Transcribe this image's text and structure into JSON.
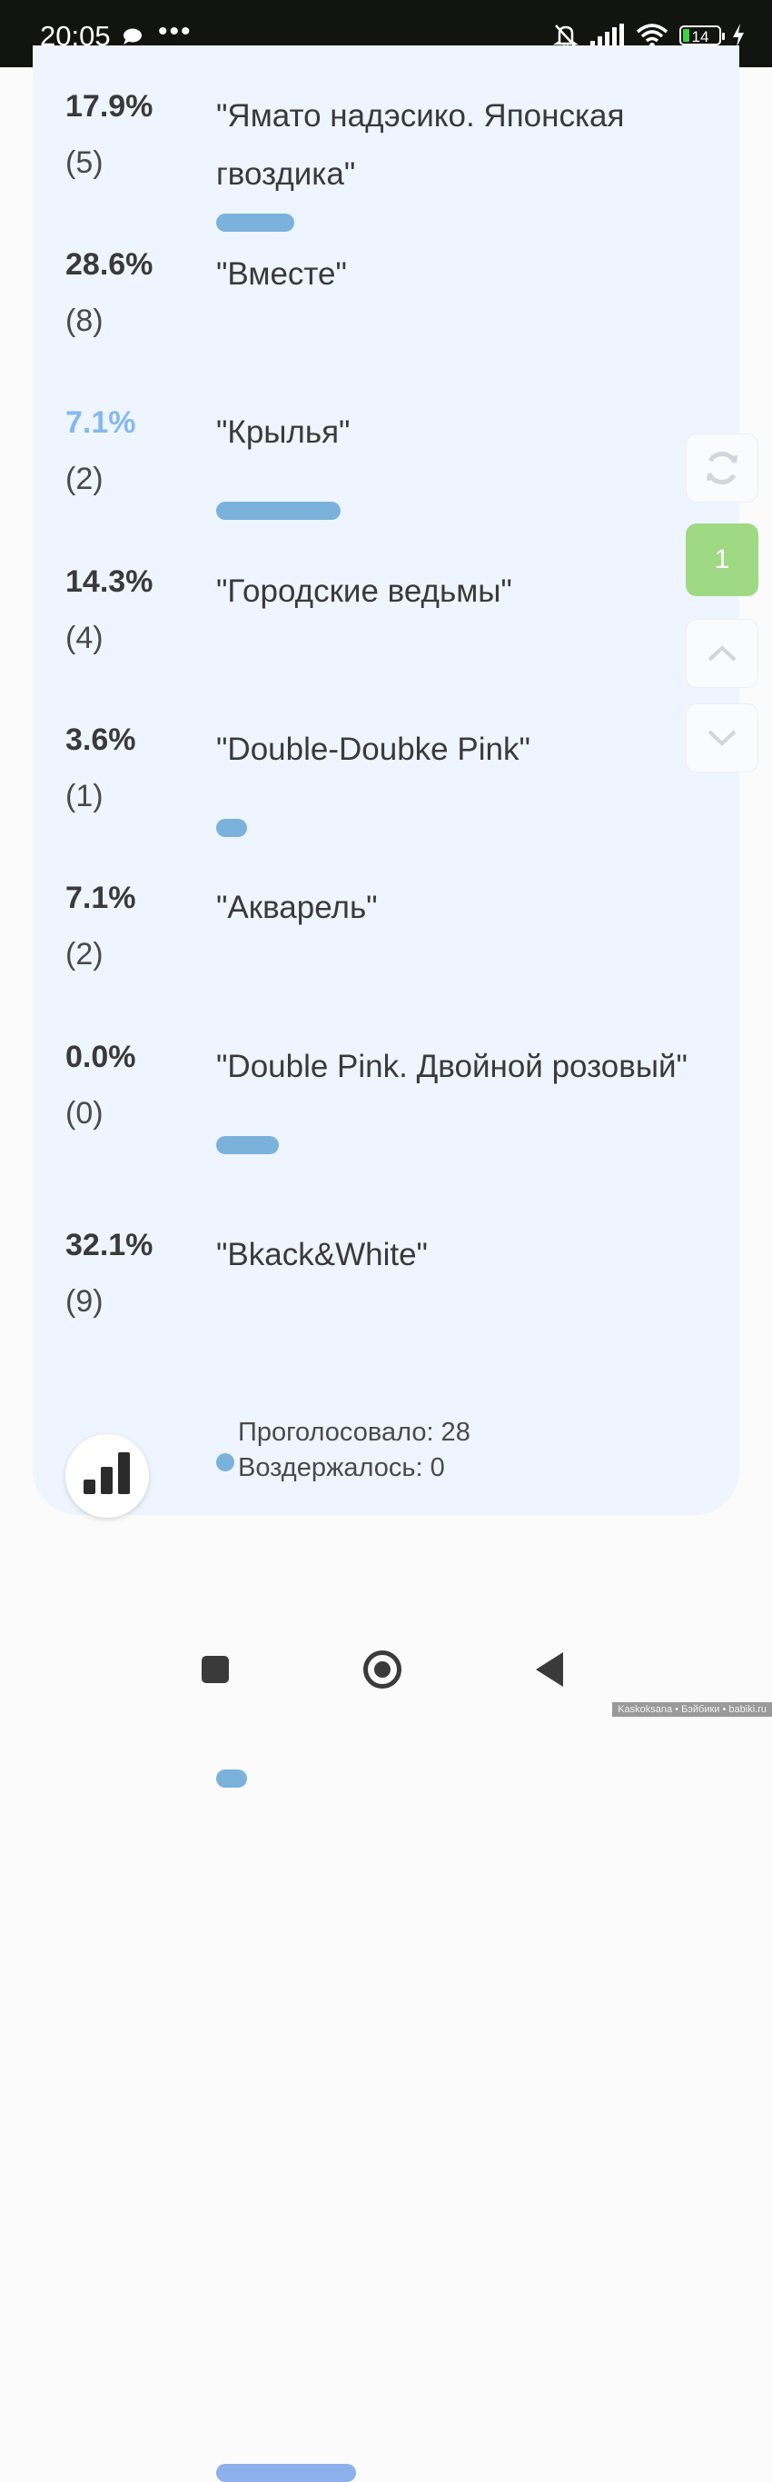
{
  "status_bar": {
    "time": "20:05",
    "overflow": "•••",
    "battery": "14",
    "icons": [
      "chat-bubble-icon",
      "bell-off-icon",
      "signal-icon",
      "wifi-icon",
      "battery-icon",
      "charging-icon"
    ]
  },
  "poll": {
    "options": [
      {
        "percent": "17.9%",
        "count": "(5)",
        "title": "\"Ямато надэсико. Японская гвоздика\"",
        "fraction": 0.179
      },
      {
        "percent": "28.6%",
        "count": "(8)",
        "title": "\"Вместе\"",
        "fraction": 0.286
      },
      {
        "percent": "7.1%",
        "count": "(2)",
        "title": "\"Крылья\"",
        "fraction": 0.071
      },
      {
        "percent": "14.3%",
        "count": "(4)",
        "title": "\"Городские ведьмы\"",
        "fraction": 0.143
      },
      {
        "percent": "3.6%",
        "count": "(1)",
        "title": "\"Double-Doubke Pink\"",
        "fraction": 0.036
      },
      {
        "percent": "7.1%",
        "count": "(2)",
        "title": "\"Акварель\"",
        "fraction": 0.071
      },
      {
        "percent": "0.0%",
        "count": "(0)",
        "title": "\"Double Pink. Двойной розовый\"",
        "fraction": 0.0
      },
      {
        "percent": "32.1%",
        "count": "(9)",
        "title": "\"Bkack&White\"",
        "fraction": 0.321
      }
    ],
    "voted": "Проголосовало: 28",
    "abstained": "Воздержалось: 0"
  },
  "float_nav": {
    "page": "1",
    "icons": [
      "refresh-icon",
      "chevron-up-icon",
      "chevron-down-icon"
    ]
  },
  "colors": {
    "status_bar": "#12140f",
    "card_bg": "#eef5fe",
    "bar": "#7ab2dc",
    "bar_leader": "#8eb0ec",
    "page_button": "#9fd983",
    "highlight_percent": "#86b9ee"
  },
  "watermark": "Kaskoksana • Бэйбики • babiki.ru"
}
